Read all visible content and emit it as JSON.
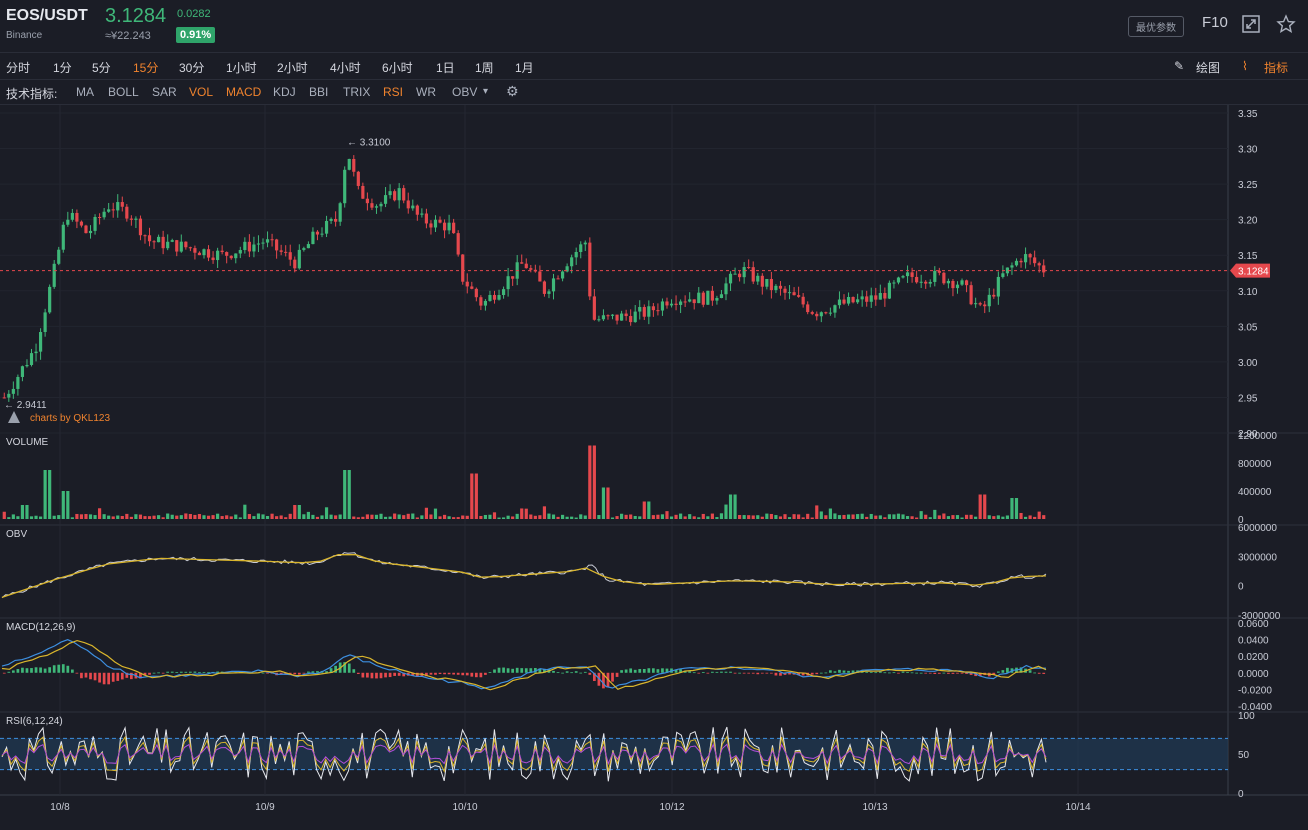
{
  "header": {
    "pair": "EOS/USDT",
    "exchange": "Binance",
    "price": "3.1284",
    "change": "0.0282",
    "cny": "≈¥22.243",
    "change_pct": "0.91%",
    "best_params": "最优参数",
    "f10": "F10"
  },
  "intervals": [
    "分时",
    "1分",
    "5分",
    "15分",
    "30分",
    "1小时",
    "2小时",
    "4小时",
    "6小时",
    "1日",
    "1周",
    "1月"
  ],
  "active_interval": "15分",
  "tools": {
    "draw_label": "绘图",
    "indicator_label": "指标"
  },
  "indicator_bar": {
    "label": "技术指标:",
    "items": [
      "MA",
      "BOLL",
      "SAR",
      "VOL",
      "MACD",
      "KDJ",
      "BBI",
      "TRIX",
      "RSI",
      "WR",
      "OBV"
    ],
    "active": [
      "VOL",
      "MACD",
      "RSI"
    ]
  },
  "colors": {
    "up": "#3fb779",
    "down": "#e5484d",
    "accent": "#f0832e",
    "ma_yellow": "#d9b52c",
    "line_blue": "#3d8fe0",
    "rsi_band": "#1f3a55"
  },
  "watermark": "charts by QKL123",
  "chart_data": [
    {
      "panel": "price",
      "type": "candlestick",
      "x_ticks": [
        "10/8",
        "10/9",
        "10/10",
        "10/12",
        "10/13",
        "10/14"
      ],
      "y_ticks": [
        "3.35",
        "3.30",
        "3.25",
        "3.20",
        "3.15",
        "3.10",
        "3.05",
        "3.00",
        "2.95",
        "2.90"
      ],
      "ylim": [
        2.9,
        3.35
      ],
      "current_price_label": "3.1284",
      "high_label": "3.3100",
      "low_label": "2.9411",
      "waypoints": [
        [
          0,
          2.95
        ],
        [
          0.03,
          3.02
        ],
        [
          0.05,
          3.14
        ],
        [
          0.06,
          3.21
        ],
        [
          0.08,
          3.18
        ],
        [
          0.1,
          3.22
        ],
        [
          0.12,
          3.21
        ],
        [
          0.14,
          3.17
        ],
        [
          0.18,
          3.16
        ],
        [
          0.21,
          3.15
        ],
        [
          0.25,
          3.17
        ],
        [
          0.28,
          3.14
        ],
        [
          0.3,
          3.18
        ],
        [
          0.32,
          3.2
        ],
        [
          0.33,
          3.3
        ],
        [
          0.34,
          3.24
        ],
        [
          0.36,
          3.22
        ],
        [
          0.38,
          3.24
        ],
        [
          0.4,
          3.2
        ],
        [
          0.43,
          3.19
        ],
        [
          0.44,
          3.12
        ],
        [
          0.46,
          3.08
        ],
        [
          0.48,
          3.11
        ],
        [
          0.5,
          3.14
        ],
        [
          0.52,
          3.1
        ],
        [
          0.54,
          3.14
        ],
        [
          0.56,
          3.17
        ],
        [
          0.565,
          3.06
        ],
        [
          0.58,
          3.06
        ],
        [
          0.62,
          3.07
        ],
        [
          0.64,
          3.09
        ],
        [
          0.68,
          3.09
        ],
        [
          0.71,
          3.13
        ],
        [
          0.73,
          3.11
        ],
        [
          0.76,
          3.09
        ],
        [
          0.78,
          3.07
        ],
        [
          0.8,
          3.08
        ],
        [
          0.84,
          3.09
        ],
        [
          0.87,
          3.12
        ],
        [
          0.9,
          3.12
        ],
        [
          0.92,
          3.11
        ],
        [
          0.94,
          3.07
        ],
        [
          0.96,
          3.12
        ],
        [
          0.98,
          3.15
        ],
        [
          1.0,
          3.13
        ]
      ],
      "candle_count": 230
    },
    {
      "panel": "volume",
      "title": "VOLUME",
      "type": "bar",
      "y_ticks": [
        "1200000",
        "800000",
        "400000",
        "0"
      ],
      "ylim": [
        0,
        1200000
      ],
      "spikes": [
        [
          0.02,
          200000
        ],
        [
          0.04,
          700000
        ],
        [
          0.06,
          400000
        ],
        [
          0.28,
          200000
        ],
        [
          0.33,
          700000
        ],
        [
          0.45,
          650000
        ],
        [
          0.565,
          1050000
        ],
        [
          0.58,
          450000
        ],
        [
          0.62,
          250000
        ],
        [
          0.7,
          350000
        ],
        [
          0.94,
          350000
        ],
        [
          0.97,
          300000
        ]
      ]
    },
    {
      "panel": "obv",
      "title": "OBV",
      "type": "line",
      "y_ticks": [
        "6000000",
        "3000000",
        "0",
        "-3000000"
      ],
      "ylim": [
        -3000000,
        6000000
      ],
      "waypoints": [
        [
          0,
          -1200000
        ],
        [
          0.05,
          600000
        ],
        [
          0.1,
          2200000
        ],
        [
          0.15,
          2800000
        ],
        [
          0.25,
          2500000
        ],
        [
          0.3,
          2300000
        ],
        [
          0.33,
          3500000
        ],
        [
          0.36,
          2400000
        ],
        [
          0.44,
          1400000
        ],
        [
          0.46,
          800000
        ],
        [
          0.55,
          1500000
        ],
        [
          0.565,
          2000000
        ],
        [
          0.58,
          600000
        ],
        [
          0.62,
          100000
        ],
        [
          0.7,
          500000
        ],
        [
          0.75,
          400000
        ],
        [
          0.8,
          100000
        ],
        [
          0.9,
          300000
        ],
        [
          0.94,
          0
        ],
        [
          0.97,
          900000
        ],
        [
          1.0,
          1000000
        ]
      ]
    },
    {
      "panel": "macd",
      "title": "MACD(12,26,9)",
      "type": "line",
      "y_ticks": [
        "0.0600",
        "0.0400",
        "0.0200",
        "0.0000",
        "-0.0200",
        "-0.0400"
      ],
      "ylim": [
        -0.045,
        0.065
      ],
      "waypoints": [
        [
          0,
          0.008
        ],
        [
          0.04,
          0.025
        ],
        [
          0.06,
          0.04
        ],
        [
          0.08,
          0.03
        ],
        [
          0.1,
          0.01
        ],
        [
          0.13,
          -0.005
        ],
        [
          0.18,
          -0.003
        ],
        [
          0.25,
          0.002
        ],
        [
          0.28,
          -0.004
        ],
        [
          0.31,
          0.002
        ],
        [
          0.33,
          0.022
        ],
        [
          0.36,
          0.008
        ],
        [
          0.4,
          -0.005
        ],
        [
          0.44,
          -0.012
        ],
        [
          0.46,
          -0.02
        ],
        [
          0.48,
          -0.01
        ],
        [
          0.52,
          0.005
        ],
        [
          0.56,
          0.008
        ],
        [
          0.58,
          -0.02
        ],
        [
          0.61,
          -0.01
        ],
        [
          0.65,
          0.004
        ],
        [
          0.7,
          0.006
        ],
        [
          0.73,
          0.004
        ],
        [
          0.78,
          -0.006
        ],
        [
          0.82,
          0.002
        ],
        [
          0.87,
          0.004
        ],
        [
          0.92,
          0.002
        ],
        [
          0.95,
          -0.006
        ],
        [
          0.98,
          0.008
        ],
        [
          1.0,
          0.005
        ]
      ]
    },
    {
      "panel": "rsi",
      "title": "RSI(6,12,24)",
      "type": "line",
      "y_ticks": [
        "100",
        "50",
        "0"
      ],
      "ylim": [
        0,
        100
      ],
      "band": [
        30,
        70
      ]
    }
  ]
}
